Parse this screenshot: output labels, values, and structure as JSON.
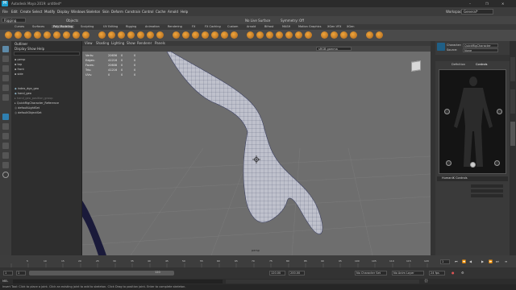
{
  "app": {
    "logo": "M",
    "title_line": "Autodesk Maya 2019: untitled*",
    "window_controls": [
      "–",
      "❐",
      "✕"
    ]
  },
  "menubar": {
    "items": [
      "File",
      "Edit",
      "Create",
      "Select",
      "Modify",
      "Display",
      "Windows",
      "Skeleton",
      "Skin",
      "Deform",
      "Constrain",
      "Control",
      "Cache",
      "Arnold",
      "Help"
    ],
    "workspace_label": "Workspace:",
    "workspace_value": "General*"
  },
  "statusline": {
    "mode": "Rigging",
    "objects_label": "Objects",
    "live_surface": "No Live Surface",
    "symmetry": "Symmetry: Off"
  },
  "shelf": {
    "tabs": [
      "Curves",
      "Surfaces",
      "Poly Modeling",
      "Sculpting",
      "UV Editing",
      "Rigging",
      "Animation",
      "Rendering",
      "FX",
      "FX Caching",
      "Custom",
      "Arnold",
      "Bifrost",
      "MASH",
      "Motion Graphics",
      "XGen VFX",
      "XGen"
    ],
    "active_tab": "Poly Modeling"
  },
  "outliner": {
    "title": "Outliner",
    "menu": [
      "Display",
      "Show",
      "Help"
    ],
    "items": [
      "persp",
      "top",
      "front",
      "side",
      "index_dgn_geo",
      "hand_geo",
      "hand_geo_position_group",
      "QuickRigCharacter_Reference",
      "defaultLightSet",
      "defaultObjectSet"
    ]
  },
  "viewport": {
    "menu": [
      "View",
      "Shading",
      "Lighting",
      "Show",
      "Renderer",
      "Panels"
    ],
    "colorspace": "sRGB gamma",
    "camera_label": "persp",
    "hud": [
      {
        "label": "Verts:",
        "a": "20656",
        "b": "0",
        "c": "0"
      },
      {
        "label": "Edges:",
        "a": "41216",
        "b": "0",
        "c": "0"
      },
      {
        "label": "Faces:",
        "a": "20608",
        "b": "0",
        "c": "0"
      },
      {
        "label": "Tris:",
        "a": "41216",
        "b": "0",
        "c": "0"
      },
      {
        "label": "UVs:",
        "a": "0",
        "b": "0",
        "c": "0"
      }
    ]
  },
  "hik": {
    "character_label": "Character:",
    "character_value": "QuickRigCharacter",
    "source_label": "Source:",
    "source_value": "None",
    "tabs": [
      "Definition",
      "Controls"
    ],
    "section": "HumanIK Controls"
  },
  "timeslider": {
    "ticks": [
      "5",
      "10",
      "15",
      "20",
      "25",
      "30",
      "35",
      "40",
      "45",
      "50",
      "55",
      "60",
      "65",
      "70",
      "75",
      "80",
      "85",
      "90",
      "95",
      "100",
      "105",
      "110",
      "115",
      "120"
    ],
    "current_frame": "1"
  },
  "rangeslider": {
    "start": "1",
    "range_start": "1",
    "range_end": "120",
    "end_a": "120.00",
    "end_b": "200.00",
    "character_set": "No Character Set",
    "anim_layer": "No Anim Layer",
    "fps": "24 fps"
  },
  "cmdline": {
    "lang": "MEL"
  },
  "helpline": {
    "text": "Insert Tool: Click to place a joint. Click an existing joint to add to skeleton. Click Drag to position joint. Enter to complete skeleton."
  },
  "colors": {
    "accent": "#00a0e0",
    "shelf_orange": "#f0a63c",
    "viewport_bg": "#6e6e6e"
  }
}
